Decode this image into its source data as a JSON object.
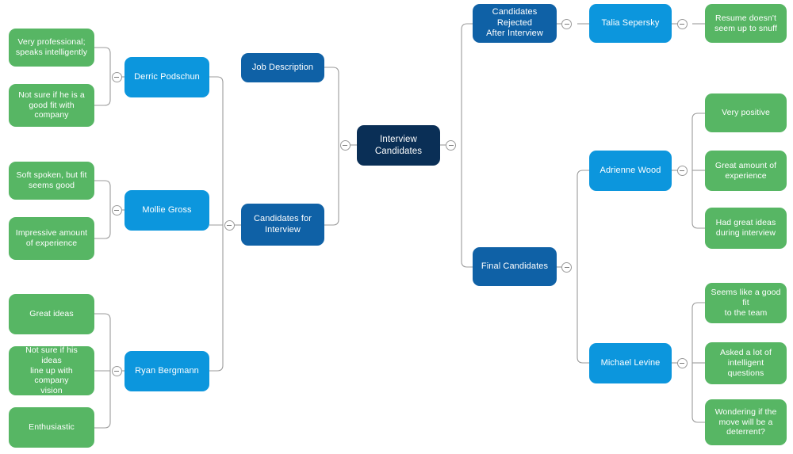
{
  "diagram": {
    "type": "mind-map",
    "title": "Interview Candidates",
    "background": "#ffffff",
    "edge_color": "#9b9b9b",
    "colors": {
      "root": "#0a2f56",
      "level1": "#0f61a6",
      "level2": "#0c96dd",
      "leaf": "#57b664",
      "toggle_border": "#9a9a9a",
      "toggle_minus": "#7c7c7c",
      "text": "#ffffff"
    },
    "toggle_icon": "collapse-minus-icon"
  },
  "nodes": {
    "root": {
      "label": "Interview Candidates",
      "level": "root"
    },
    "job_description": {
      "label": "Job Description",
      "level": "level1"
    },
    "candidates_for_interview": {
      "label": "Candidates for\nInterview",
      "level": "level1"
    },
    "candidates_rejected": {
      "label": "Candidates Rejected\nAfter Interview",
      "level": "level1"
    },
    "final_candidates": {
      "label": "Final Candidates",
      "level": "level1"
    },
    "derric_podschun": {
      "label": "Derric Podschun",
      "level": "level2"
    },
    "mollie_gross": {
      "label": "Mollie Gross",
      "level": "level2"
    },
    "ryan_bergmann": {
      "label": "Ryan Bergmann",
      "level": "level2"
    },
    "talia_sepersky": {
      "label": "Talia Sepersky",
      "level": "level2"
    },
    "adrienne_wood": {
      "label": "Adrienne Wood",
      "level": "level2"
    },
    "michael_levine": {
      "label": "Michael Levine",
      "level": "level2"
    },
    "derric_note_1": {
      "label": "Very professional;\nspeaks intelligently",
      "level": "leaf"
    },
    "derric_note_2": {
      "label": "Not sure if he is a\ngood fit with\ncompany",
      "level": "leaf"
    },
    "mollie_note_1": {
      "label": "Soft spoken, but fit\nseems good",
      "level": "leaf"
    },
    "mollie_note_2": {
      "label": "Impressive amount\nof experience",
      "level": "leaf"
    },
    "ryan_note_1": {
      "label": "Great ideas",
      "level": "leaf"
    },
    "ryan_note_2": {
      "label": "Not sure if his ideas\nline up with company\nvision",
      "level": "leaf"
    },
    "ryan_note_3": {
      "label": "Enthusiastic",
      "level": "leaf"
    },
    "talia_note_1": {
      "label": "Resume doesn't\nseem up to snuff",
      "level": "leaf"
    },
    "adrienne_note_1": {
      "label": "Very positive",
      "level": "leaf"
    },
    "adrienne_note_2": {
      "label": "Great amount of\nexperience",
      "level": "leaf"
    },
    "adrienne_note_3": {
      "label": "Had great ideas\nduring interview",
      "level": "leaf"
    },
    "michael_note_1": {
      "label": "Seems like a good fit\nto the team",
      "level": "leaf"
    },
    "michael_note_2": {
      "label": "Asked a lot of\nintelligent questions",
      "level": "leaf"
    },
    "michael_note_3": {
      "label": "Wondering if the\nmove will be a\ndeterrent?",
      "level": "leaf"
    }
  },
  "edges": [
    {
      "from": "root",
      "to": "job_description",
      "side": "left"
    },
    {
      "from": "root",
      "to": "candidates_for_interview",
      "side": "left"
    },
    {
      "from": "candidates_for_interview",
      "to": "derric_podschun",
      "side": "left"
    },
    {
      "from": "candidates_for_interview",
      "to": "mollie_gross",
      "side": "left"
    },
    {
      "from": "candidates_for_interview",
      "to": "ryan_bergmann",
      "side": "left"
    },
    {
      "from": "derric_podschun",
      "to": "derric_note_1",
      "side": "left"
    },
    {
      "from": "derric_podschun",
      "to": "derric_note_2",
      "side": "left"
    },
    {
      "from": "mollie_gross",
      "to": "mollie_note_1",
      "side": "left"
    },
    {
      "from": "mollie_gross",
      "to": "mollie_note_2",
      "side": "left"
    },
    {
      "from": "ryan_bergmann",
      "to": "ryan_note_1",
      "side": "left"
    },
    {
      "from": "ryan_bergmann",
      "to": "ryan_note_2",
      "side": "left"
    },
    {
      "from": "ryan_bergmann",
      "to": "ryan_note_3",
      "side": "left"
    },
    {
      "from": "root",
      "to": "candidates_rejected",
      "side": "right"
    },
    {
      "from": "root",
      "to": "final_candidates",
      "side": "right"
    },
    {
      "from": "candidates_rejected",
      "to": "talia_sepersky",
      "side": "right"
    },
    {
      "from": "talia_sepersky",
      "to": "talia_note_1",
      "side": "right"
    },
    {
      "from": "final_candidates",
      "to": "adrienne_wood",
      "side": "right"
    },
    {
      "from": "final_candidates",
      "to": "michael_levine",
      "side": "right"
    },
    {
      "from": "adrienne_wood",
      "to": "adrienne_note_1",
      "side": "right"
    },
    {
      "from": "adrienne_wood",
      "to": "adrienne_note_2",
      "side": "right"
    },
    {
      "from": "adrienne_wood",
      "to": "adrienne_note_3",
      "side": "right"
    },
    {
      "from": "michael_levine",
      "to": "michael_note_1",
      "side": "right"
    },
    {
      "from": "michael_levine",
      "to": "michael_note_2",
      "side": "right"
    },
    {
      "from": "michael_levine",
      "to": "michael_note_3",
      "side": "right"
    }
  ]
}
